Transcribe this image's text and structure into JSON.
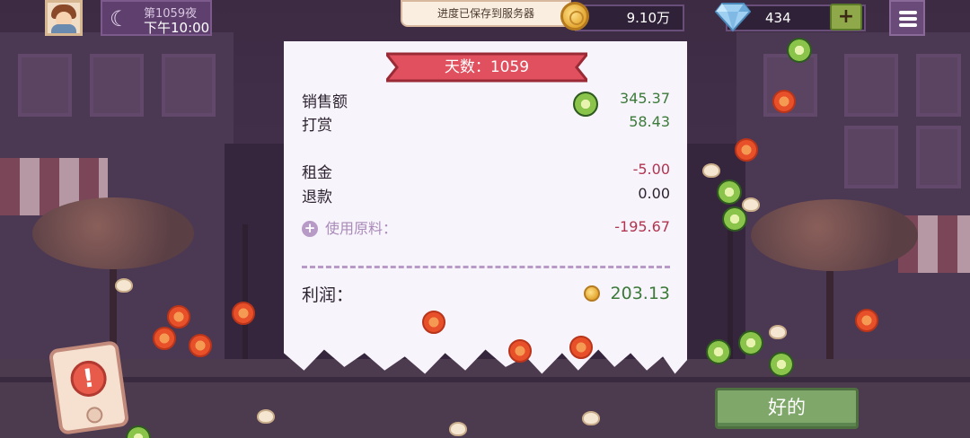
{
  "hud": {
    "night_label": "第1059夜",
    "time_label": "下午10:00",
    "toast": "进度已保存到服务器",
    "coins": "9.10万",
    "gems": "434",
    "gem_add": "+"
  },
  "receipt": {
    "banner": "天数：1059",
    "rows": [
      {
        "label": "销售额",
        "value": "345.37"
      },
      {
        "label": "打赏",
        "value": "58.43"
      },
      {
        "label": "租金",
        "value": "-5.00"
      },
      {
        "label": "退款",
        "value": "0.00"
      }
    ],
    "ingredients_label": "使用原料：",
    "ingredients_value": "-195.67",
    "profit_label": "利润：",
    "profit_value": "203.13"
  },
  "actions": {
    "ok_label": "好的"
  },
  "colors": {
    "positive": "#3c7a3a",
    "negative": "#b13550",
    "banner_red": "#e0505e",
    "ok_green": "#7fa769"
  },
  "icons": [
    "moon-icon",
    "coin-icon",
    "diamond-icon",
    "menu-icon",
    "plus-icon",
    "alert-icon"
  ]
}
